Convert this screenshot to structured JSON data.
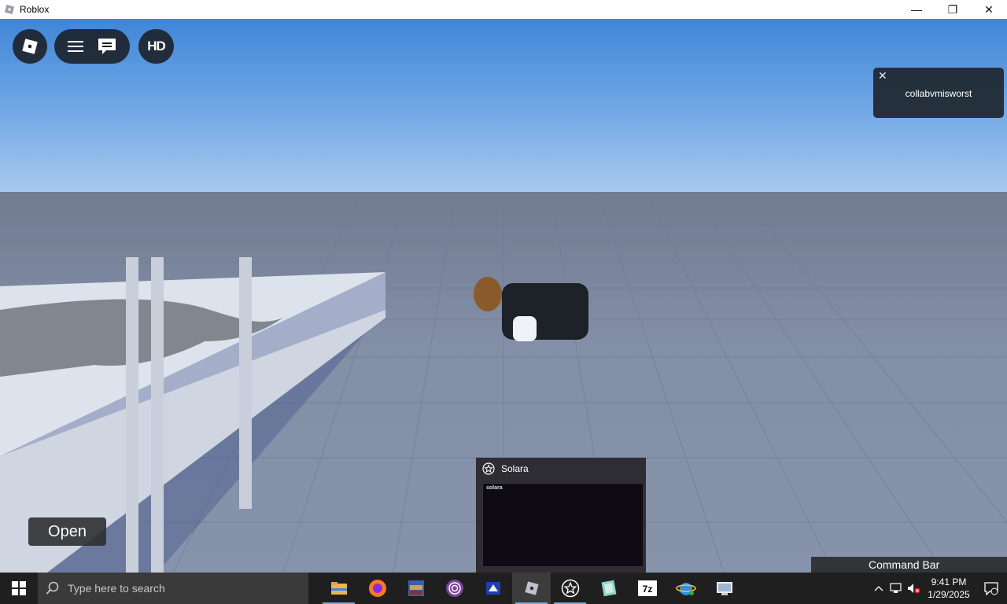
{
  "window": {
    "title": "Roblox",
    "minimize": "—",
    "restore": "❐",
    "close": "✕"
  },
  "roblox_ui": {
    "hd_label": "HD"
  },
  "notification": {
    "close": "✕",
    "message": "collabvmisworst"
  },
  "open_label": "Open",
  "solara_preview": {
    "title": "Solara",
    "thumb_title": "solara"
  },
  "command_bar": "Command Bar",
  "taskbar": {
    "search_placeholder": "Type here to search",
    "apps": [
      "file-explorer",
      "firefox",
      "winrar",
      "tor-browser",
      "paint",
      "roblox",
      "solara",
      "notepad-plus",
      "7-zip",
      "internet-explorer",
      "control-panel"
    ],
    "time": "9:41 PM",
    "date": "1/29/2025"
  }
}
